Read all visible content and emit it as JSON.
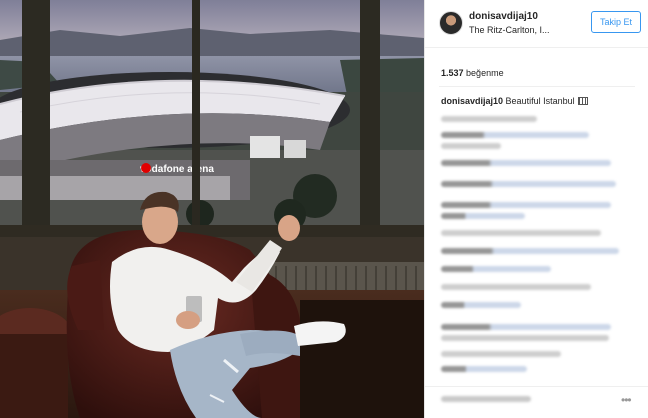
{
  "post": {
    "username": "donisavdijaj10",
    "location": "The Ritz-Carlton, I...",
    "follow_label": "Takip Et",
    "likes_count": "1.537",
    "likes_label": "beğenme",
    "caption_user": "donisavdijaj10",
    "caption_text": "Beautiful Istanbul",
    "photo_sign_text": "vodafone arena"
  },
  "colors": {
    "accent": "#3897f0",
    "text": "#262626",
    "blurred_mention": "#c7d3e6",
    "sky_top": "#8e8fa6",
    "stadium_roof": "#e8e6ea"
  },
  "icons": [
    "avatar",
    "flag-emoji-icon",
    "more-options-icon"
  ]
}
